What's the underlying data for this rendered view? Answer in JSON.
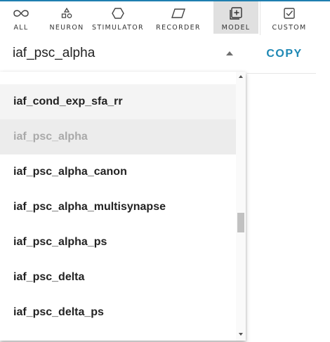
{
  "toolbar": {
    "items": [
      {
        "label": "ALL",
        "icon": "infinity-icon"
      },
      {
        "label": "NEURON",
        "icon": "neuron-icon"
      },
      {
        "label": "STIMULATOR",
        "icon": "hexagon-icon"
      },
      {
        "label": "RECORDER",
        "icon": "parallelogram-icon"
      },
      {
        "label": "MODEL",
        "icon": "plus-box-icon",
        "active": true
      },
      {
        "label": "CUSTOM",
        "icon": "checkbox-icon"
      }
    ]
  },
  "model_select": {
    "value": "iaf_psc_alpha",
    "options": [
      "iaf_cond_exp_sfa_rr",
      "iaf_psc_alpha",
      "iaf_psc_alpha_canon",
      "iaf_psc_alpha_multisynapse",
      "iaf_psc_alpha_ps",
      "iaf_psc_delta",
      "iaf_psc_delta_ps"
    ],
    "selected_index": 1,
    "hover_index": 0
  },
  "copy_label": "COPY",
  "colors": {
    "accent": "#1e88b4",
    "active_tab_bg": "#e0e0e0",
    "selected_option_bg": "#ececec",
    "selected_option_text": "#a9a9a9"
  }
}
